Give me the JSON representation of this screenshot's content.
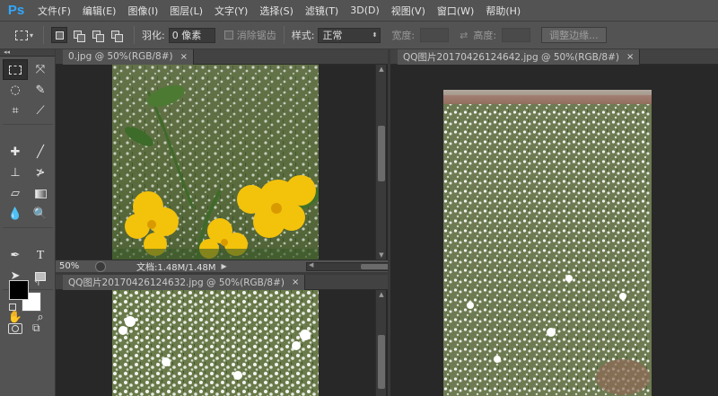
{
  "app": {
    "logo": "Ps"
  },
  "menu": [
    "文件(F)",
    "编辑(E)",
    "图像(I)",
    "图层(L)",
    "文字(Y)",
    "选择(S)",
    "滤镜(T)",
    "3D(D)",
    "视图(V)",
    "窗口(W)",
    "帮助(H)"
  ],
  "options": {
    "feather_label": "羽化:",
    "feather_value": "0 像素",
    "antialias_label": "消除锯齿",
    "style_label": "样式:",
    "style_value": "正常",
    "width_label": "宽度:",
    "height_label": "高度:",
    "refine_button": "调整边缘..."
  },
  "documents": {
    "doc1": {
      "tab": "0.jpg @ 50%(RGB/8#)",
      "close": "×"
    },
    "doc2": {
      "tab": "QQ图片20170426124632.jpg @ 50%(RGB/8#)",
      "close": "×"
    },
    "doc3": {
      "tab": "QQ图片20170426124642.jpg @ 50%(RGB/8#)",
      "close": "×"
    }
  },
  "status": {
    "zoom": "50%",
    "doc_info": "文档:1.48M/1.48M"
  },
  "colors": {
    "foreground": "#000000",
    "background": "#ffffff",
    "accent": "#31a8ff"
  },
  "tools": [
    "marquee-icon",
    "move-icon",
    "lasso-icon",
    "quick-select-icon",
    "crop-icon",
    "eyedropper-icon",
    "spot-heal-icon",
    "brush-icon",
    "clone-stamp-icon",
    "history-brush-icon",
    "eraser-icon",
    "gradient-icon",
    "blur-icon",
    "dodge-icon",
    "pen-icon",
    "type-icon",
    "path-select-icon",
    "rectangle-icon",
    "hand-icon",
    "zoom-icon"
  ]
}
